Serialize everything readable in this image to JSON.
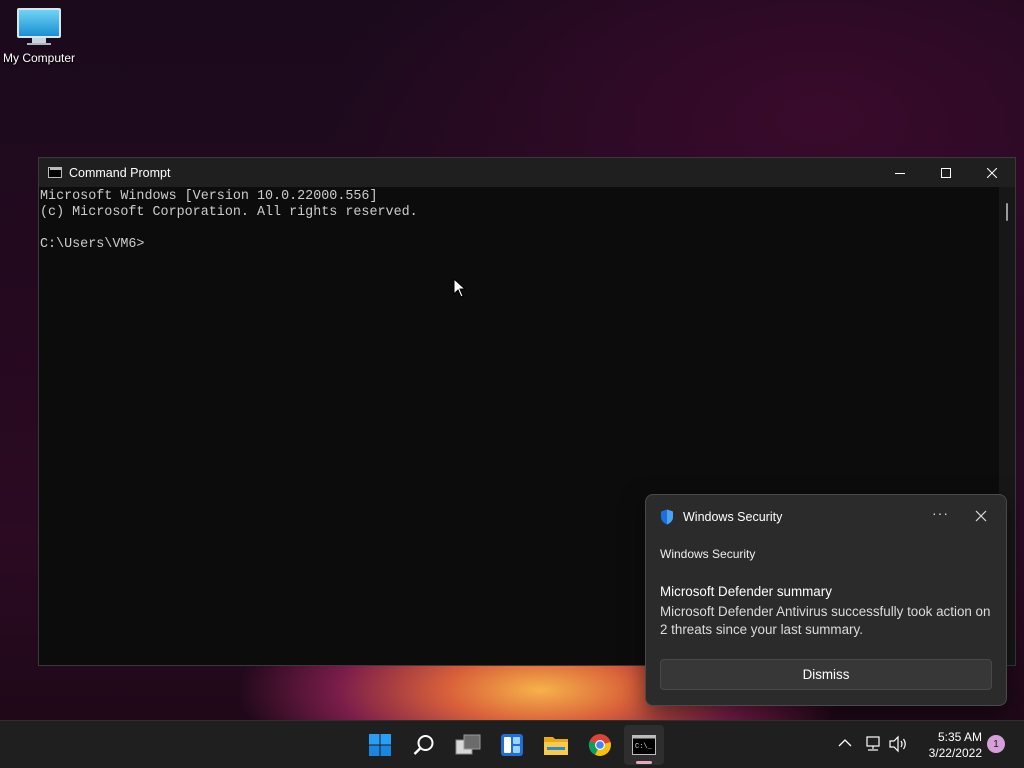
{
  "desktop": {
    "icons": [
      {
        "label": "My Computer",
        "icon": "computer-icon"
      }
    ]
  },
  "cmd_window": {
    "title": "Command Prompt",
    "console_lines": [
      "Microsoft Windows [Version 10.0.22000.556]",
      "(c) Microsoft Corporation. All rights reserved.",
      "",
      "C:\\Users\\VM6>"
    ]
  },
  "notification": {
    "app_name": "Windows Security",
    "source": "Windows Security",
    "headline": "Microsoft Defender summary",
    "body": "Microsoft Defender Antivirus successfully took action on 2 threats since your last summary.",
    "dismiss_label": "Dismiss",
    "more_label": "···"
  },
  "taskbar": {
    "apps": [
      "start-icon",
      "search-icon",
      "task-view-icon",
      "widgets-icon",
      "file-explorer-icon",
      "chrome-icon",
      "command-prompt-icon"
    ],
    "active_app": "command-prompt-icon",
    "clock": {
      "time": "5:35 AM",
      "date": "3/22/2022"
    },
    "notification_count": "1"
  },
  "colors": {
    "accent": "#0078d4",
    "console_text": "#cccccc",
    "badge": "#d59fd9"
  }
}
